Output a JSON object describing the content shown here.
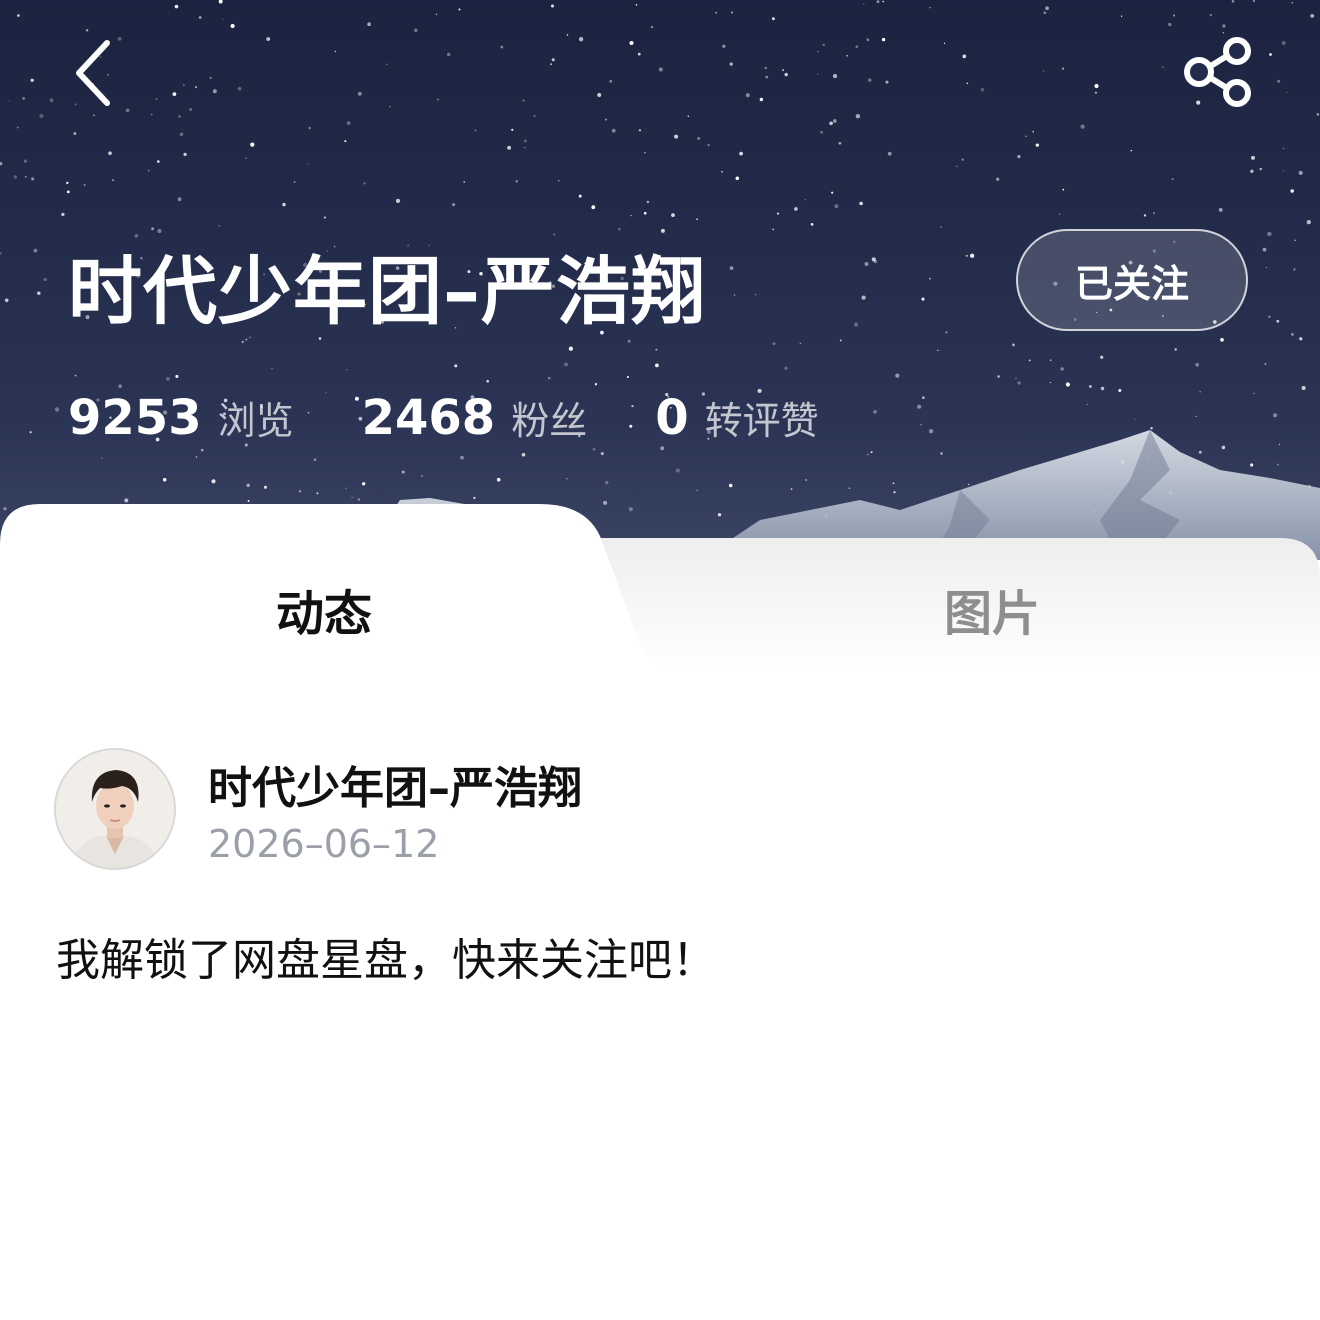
{
  "header": {
    "back_icon": "chevron-left-icon",
    "share_icon": "share-icon",
    "title": "时代少年团–严浩翔",
    "follow_label": "已关注"
  },
  "stats": [
    {
      "value": "9253",
      "label": "浏览"
    },
    {
      "value": "2468",
      "label": "粉丝"
    },
    {
      "value": "0",
      "label": "转评赞"
    }
  ],
  "tabs": [
    {
      "label": "动态",
      "active": true
    },
    {
      "label": "图片",
      "active": false
    }
  ],
  "post": {
    "author": "时代少年团–严浩翔",
    "date": "2026–06–12",
    "content": "我解锁了网盘星盘，快来关注吧！",
    "avatar_icon": "user-avatar"
  },
  "colors": {
    "sky": "#232b4a",
    "active_tab_text": "#111111",
    "inactive_tab_text": "#8e8e8e",
    "date_text": "#9a9fa8"
  }
}
